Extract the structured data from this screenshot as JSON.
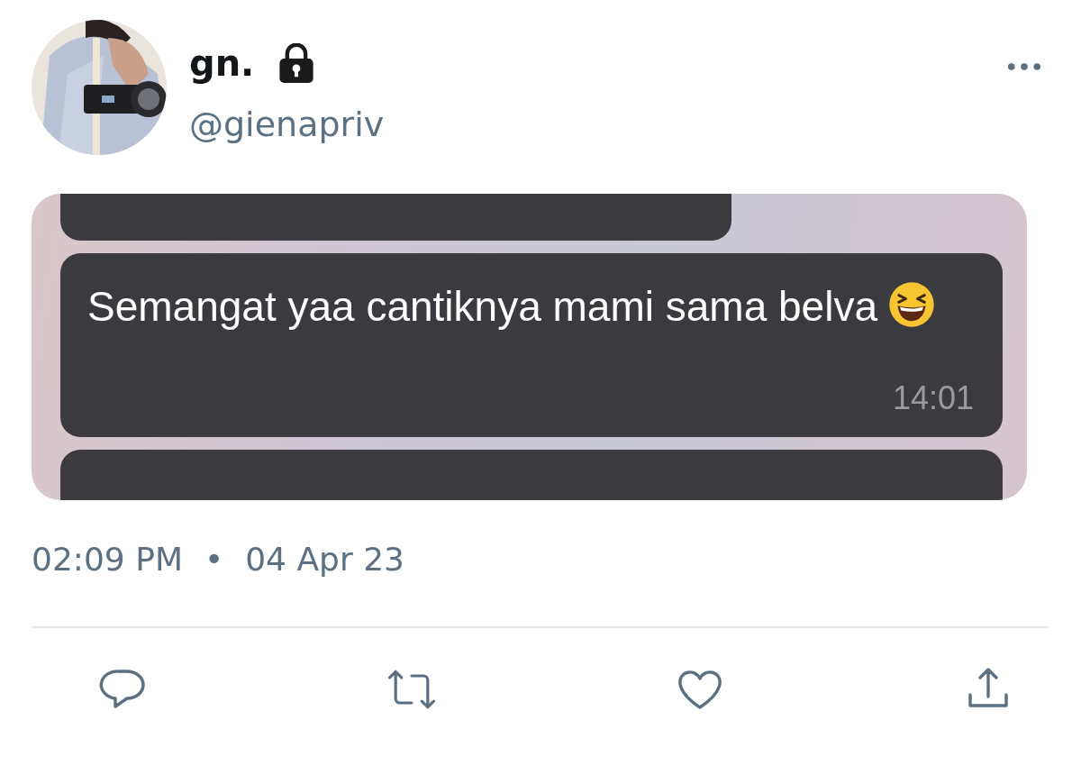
{
  "author": {
    "name": "gn.",
    "locked": true,
    "handle": "@gienapriv"
  },
  "media": {
    "messages": [
      {
        "text": "Semangat yaa cantiknya mami sama belva",
        "emoji": true,
        "time": "14:01"
      }
    ]
  },
  "meta": {
    "time": "02:09 PM",
    "separator": "•",
    "date": "04 Apr 23"
  },
  "actions": [
    {
      "kind": "reply"
    },
    {
      "kind": "retweet"
    },
    {
      "kind": "like"
    },
    {
      "kind": "share"
    }
  ]
}
